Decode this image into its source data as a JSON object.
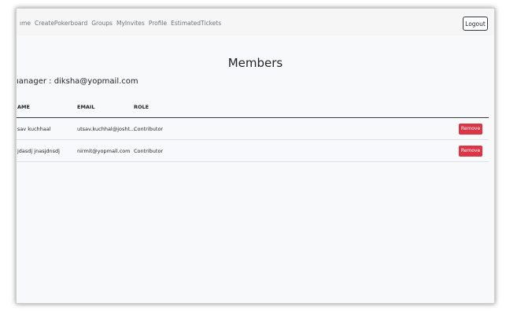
{
  "nav": {
    "links": [
      "ıme",
      "CreatePokerboard",
      "Groups",
      "MyInvites",
      "Profile",
      "EstimatedTickets"
    ],
    "logout_label": "Logout"
  },
  "page": {
    "title": "Members",
    "manager_text": "ıanager : diksha@yopmail.com"
  },
  "table": {
    "headers": [
      "AME",
      "EMAIL",
      "ROLE"
    ],
    "rows": [
      {
        "name": "sav kuchhaal",
        "email": "utsav.kuchhal@josht...",
        "role": "Contributor",
        "action": "Remove"
      },
      {
        "name": "jdasdj jnasjdnsdj",
        "email": "nirmit@yopmail.com",
        "role": "Contributor",
        "action": "Remove"
      }
    ]
  },
  "colors": {
    "remove_button": "#dc3545",
    "background": "#f8f9fa"
  }
}
